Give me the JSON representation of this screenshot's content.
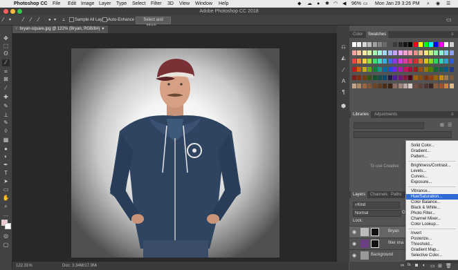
{
  "menubar": {
    "app": "Photoshop CC",
    "items": [
      "File",
      "Edit",
      "Image",
      "Layer",
      "Type",
      "Select",
      "Filter",
      "3D",
      "View",
      "Window",
      "Help"
    ],
    "battery": "96%",
    "datetime": "Mon Jan 29  3:26 PM"
  },
  "window": {
    "title": "Adobe Photoshop CC 2018"
  },
  "options": {
    "sample_all_layers": "Sample All Layers",
    "auto_enhance": "Auto-Enhance",
    "select_mask": "Select and Mask..."
  },
  "document": {
    "tab": "bryan-square.jpg @ 122% (Bryan, RGB/8#)",
    "zoom": "122.31%",
    "doc_info": "Doc: 3.34M/17.9M"
  },
  "panels": {
    "color_tab": "Color",
    "swatches_tab": "Swatches",
    "libraries_tab": "Libraries",
    "adjustments_tab": "Adjustments",
    "lib_hint": "To use Creative",
    "layers_tab": "Layers",
    "channels_tab": "Channels",
    "paths_tab": "Paths",
    "kind_filter": "Kind",
    "blend_mode": "Normal",
    "opacity_label": "Opac",
    "lock_label": "Lock:",
    "layers": [
      {
        "name": "Bryan"
      },
      {
        "name": "filler ima"
      },
      {
        "name": "Background"
      }
    ]
  },
  "adjustment_menu": {
    "groups": [
      [
        "Solid Color...",
        "Gradient...",
        "Pattern..."
      ],
      [
        "Brightness/Contrast...",
        "Levels...",
        "Curves...",
        "Exposure..."
      ],
      [
        "Vibrance...",
        "Hue/Saturation...",
        "Color Balance...",
        "Black & White...",
        "Photo Filter...",
        "Channel Mixer...",
        "Color Lookup..."
      ],
      [
        "Invert",
        "Posterize...",
        "Threshold...",
        "Gradient Map...",
        "Selective Color..."
      ]
    ],
    "selected": "Hue/Saturation..."
  },
  "colors": {
    "accent": "#2f6bd6",
    "panel": "#535353",
    "canvas_bg": "#282828"
  }
}
